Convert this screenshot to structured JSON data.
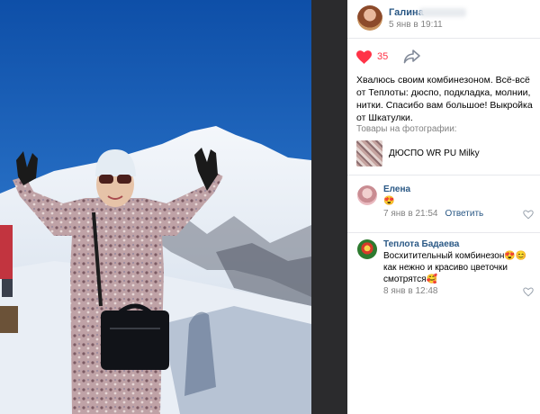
{
  "post": {
    "author_name": "Галина",
    "date": "5 янв в 19:11",
    "likes_count": "35",
    "text": "Хвалюсь своим комбинезоном. Всё-всё от Теплоты: дюспо, подкладка, молнии, нитки. Спасибо вам большое! Выкройка от Шкатулки.",
    "goods_title": "Товары на фотографии:",
    "goods_item_name": "ДЮСПО WR PU Milky"
  },
  "comments": [
    {
      "author": "Елена",
      "text": "😍",
      "date": "7 янв в 21:54",
      "reply_label": "Ответить"
    },
    {
      "author": "Теплота Бадаева",
      "text": "Восхитительный комбинезон😍😊 как нежно и красиво цветочки смотрятся🥰",
      "date": "8 янв в 12:48"
    }
  ],
  "icons": {
    "like": "heart-icon",
    "share": "share-icon",
    "comment_like": "heart-outline-icon"
  },
  "colors": {
    "link": "#2a5885",
    "like_active": "#ff3347",
    "meta": "#828282"
  }
}
